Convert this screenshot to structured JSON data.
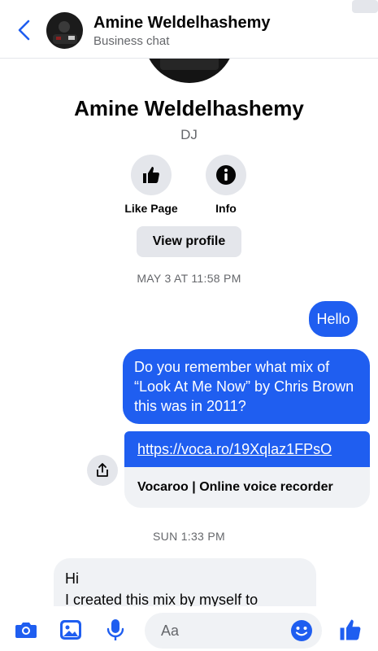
{
  "header": {
    "back_icon": "chevron-left-icon",
    "name": "Amine Weldelhashemy",
    "subtitle": "Business chat"
  },
  "profile": {
    "name": "Amine Weldelhashemy",
    "category": "DJ",
    "actions": [
      {
        "label": "Like Page",
        "icon": "thumbs-up-icon"
      },
      {
        "label": "Info",
        "icon": "info-icon"
      }
    ],
    "view_profile_label": "View profile"
  },
  "thread": {
    "timestamp_1": "MAY 3 AT 11:58 PM",
    "msg_hello": "Hello",
    "msg_question": "Do you remember what mix of “Look At Me Now” by Chris Brown this was in 2011?",
    "link_url": "https://voca.ro/19Xqlaz1FPsO",
    "link_title": "Vocaroo | Online voice recorder",
    "timestamp_2": "SUN 1:33 PM",
    "reply_line1": "Hi",
    "reply_line2": "I created this mix by myself to"
  },
  "composer": {
    "placeholder": "Aa",
    "icons": [
      "camera-icon",
      "image-icon",
      "microphone-icon",
      "emoji-icon",
      "thumbs-up-icon"
    ]
  },
  "colors": {
    "accent": "#1f5ef0",
    "muted": "#65676b",
    "bubble_in": "#f0f2f5"
  }
}
